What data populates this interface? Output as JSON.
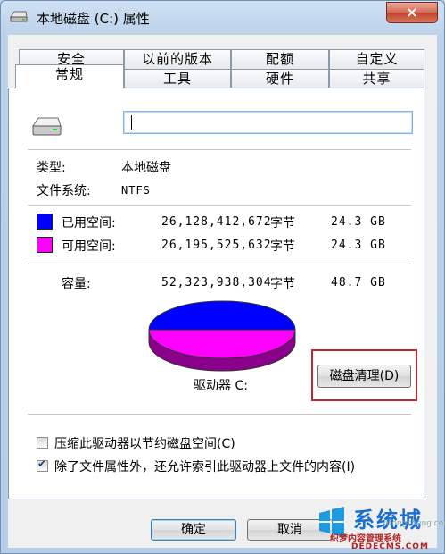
{
  "window": {
    "title": "本地磁盘 (C:) 属性",
    "close_label": "×"
  },
  "tabs_back": [
    "安全",
    "以前的版本",
    "配额",
    "自定义"
  ],
  "tabs_front": [
    "常规",
    "工具",
    "硬件",
    "共享"
  ],
  "general": {
    "name_value": "",
    "type_label": "类型:",
    "type_value": "本地磁盘",
    "fs_label": "文件系统:",
    "fs_value": "NTFS",
    "used": {
      "label": "已用空间:",
      "bytes": "26,128,412,672",
      "unit": "字节",
      "size": "24.3 GB",
      "color": "#0000ff"
    },
    "free": {
      "label": "可用空间:",
      "bytes": "26,195,525,632",
      "unit": "字节",
      "size": "24.3 GB",
      "color": "#ff00ff"
    },
    "capacity": {
      "label": "容量:",
      "bytes": "52,323,938,304",
      "unit": "字节",
      "size": "48.7 GB"
    },
    "drive_label": "驱动器 C:",
    "cleanup_button": "磁盘清理(D)",
    "compress_label": "压缩此驱动器以节约磁盘空间(C)",
    "compress_checked": false,
    "index_label": "除了文件属性外，还允许索引此驱动器上文件的内容(I)",
    "index_checked": true
  },
  "buttons": {
    "ok": "确定",
    "cancel": "取消"
  },
  "watermark": {
    "brand": "系统城",
    "sub": "织梦内容管理系统",
    "url": "DEDECMS.COM",
    "faint": "xitongcheng.com"
  }
}
